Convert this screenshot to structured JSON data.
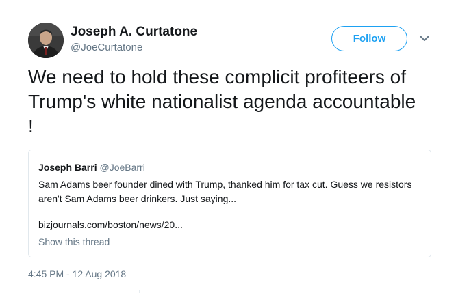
{
  "author": {
    "name": "Joseph A. Curtatone",
    "handle": "@JoeCurtatone",
    "avatar_icon": "profile-photo"
  },
  "actions": {
    "follow_label": "Follow",
    "more_icon": "chevron-down-icon"
  },
  "tweet": {
    "text": "We need to hold these complicit profiteers of\nTrump's white nationalist agenda accountable\n!",
    "timestamp": "4:45 PM - 12 Aug 2018"
  },
  "quoted_tweet": {
    "author_name": "Joseph Barri",
    "author_handle": "@JoeBarri",
    "text": "Sam Adams beer founder dined with Trump, thanked him for tax cut. Guess we resistors aren't Sam Adams beer drinkers. Just saying...",
    "link": "bizjournals.com/boston/news/20...",
    "show_thread": "Show this thread"
  },
  "colors": {
    "accent": "#1da1f2",
    "secondary_text": "#657786",
    "border": "#e1e8ed"
  }
}
